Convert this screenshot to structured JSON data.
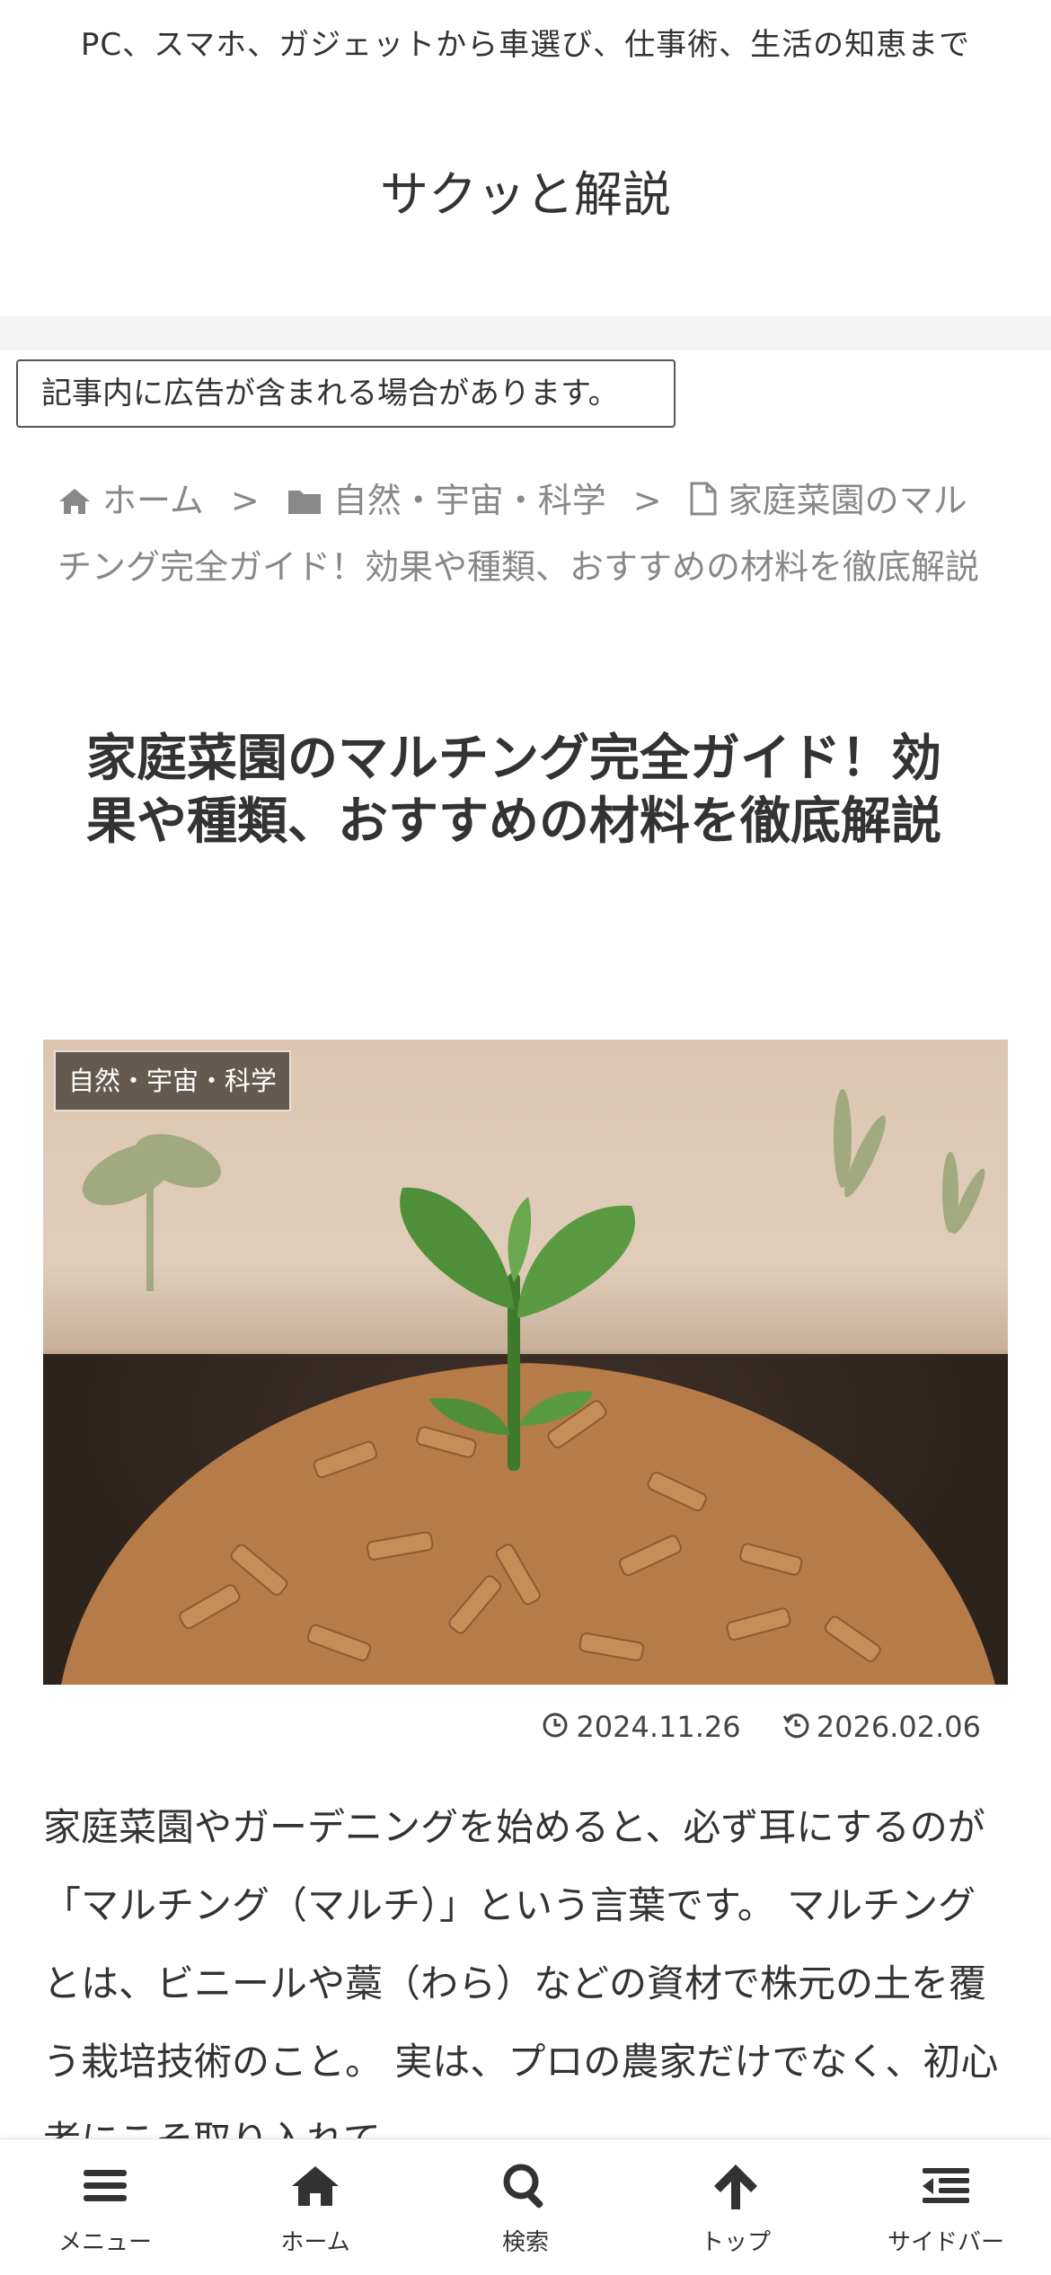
{
  "header": {
    "tagline": "PC、スマホ、ガジェットから車選び、仕事術、生活の知恵まで",
    "site_title": "サクッと解説"
  },
  "ad_notice": "記事内に広告が含まれる場合があります。",
  "breadcrumb": {
    "home": "ホーム",
    "category": "自然・宇宙・科学",
    "current": "家庭菜園のマルチング完全ガイド！効果や種類、おすすめの材料を徹底解説"
  },
  "post": {
    "title": "家庭菜園のマルチング完全ガイド！効果や種類、おすすめの材料を徹底解説",
    "category_badge": "自然・宇宙・科学",
    "published": "2024.11.26",
    "updated": "2026.02.06",
    "body": "家庭菜園やガーデニングを始めると、必ず耳にするのが「マルチング（マルチ）」という言葉です。 マルチングとは、ビニールや藁（わら）などの資材で株元の土を覆う栽培技術のこと。 実は、プロの農家だけでなく、初心者にこそ取り入れて"
  },
  "bottom_nav": {
    "items": [
      {
        "label": "メニュー",
        "icon": "menu-icon"
      },
      {
        "label": "ホーム",
        "icon": "home-icon"
      },
      {
        "label": "検索",
        "icon": "search-icon"
      },
      {
        "label": "トップ",
        "icon": "arrow-up-icon"
      },
      {
        "label": "サイドバー",
        "icon": "sidebar-icon"
      }
    ]
  }
}
